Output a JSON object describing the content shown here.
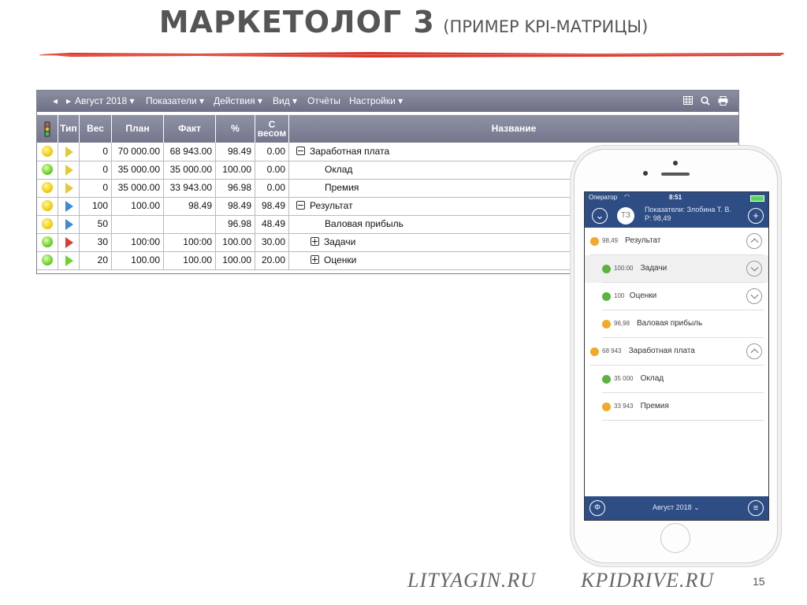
{
  "slide": {
    "title_main": "МАРКЕТОЛОГ 3",
    "title_sub": "(ПРИМЕР KPI-МАТРИЦЫ)",
    "page_number": "15",
    "site1": "LITYAGIN.RU",
    "site2": "KPIDRIVE.RU"
  },
  "colors": {
    "accent_red": "#d9362b",
    "toolbar": "#7a7c91",
    "phone_bar": "#2e4d84",
    "dot_yellow": "#f0cf10",
    "dot_green": "#6fd12e",
    "dot_orange": "#f0a928"
  },
  "desktop": {
    "toolbar": {
      "prev_icon": "triangle-left-icon",
      "next_icon": "triangle-right-icon",
      "period": "Август 2018",
      "menu": [
        "Показатели",
        "Действия",
        "Вид",
        "Отчёты",
        "Настройки"
      ],
      "right_icons": [
        "table-icon",
        "search-icon",
        "print-icon"
      ]
    },
    "headers": {
      "type": "Тип",
      "weight": "Вес",
      "plan": "План",
      "fact": "Факт",
      "percent": "%",
      "with_weight_1": "С",
      "with_weight_2": "весом",
      "name": "Название"
    },
    "rows": [
      {
        "status": "yellow",
        "type": "yellow",
        "weight": "0",
        "plan": "70 000.00",
        "fact": "68 943.00",
        "percent": "98.49",
        "weighted": "0.00",
        "name": "Заработная плата",
        "tree": "minus",
        "indent": 0
      },
      {
        "status": "green",
        "type": "yellow",
        "weight": "0",
        "plan": "35 000.00",
        "fact": "35 000.00",
        "percent": "100.00",
        "weighted": "0.00",
        "name": "Оклад",
        "tree": "",
        "indent": 2
      },
      {
        "status": "yellow",
        "type": "yellow",
        "weight": "0",
        "plan": "35 000.00",
        "fact": "33 943.00",
        "percent": "96.98",
        "weighted": "0.00",
        "name": "Премия",
        "tree": "",
        "indent": 2
      },
      {
        "status": "yellow",
        "type": "blue",
        "weight": "100",
        "plan": "100.00",
        "fact": "98.49",
        "percent": "98.49",
        "weighted": "98.49",
        "name": "Результат",
        "tree": "minus",
        "indent": 0
      },
      {
        "status": "yellow",
        "type": "blue",
        "weight": "50",
        "plan": "",
        "fact": "",
        "percent": "96.98",
        "weighted": "48.49",
        "name": "Валовая прибыль",
        "tree": "",
        "indent": 2
      },
      {
        "status": "green",
        "type": "red",
        "weight": "30",
        "plan": "100:00",
        "fact": "100:00",
        "percent": "100.00",
        "weighted": "30.00",
        "name": "Задачи",
        "tree": "plus",
        "indent": 1
      },
      {
        "status": "green",
        "type": "green",
        "weight": "20",
        "plan": "100.00",
        "fact": "100.00",
        "percent": "100.00",
        "weighted": "20.00",
        "name": "Оценки",
        "tree": "plus",
        "indent": 1
      }
    ]
  },
  "phone": {
    "status": {
      "carrier": "Оператор",
      "time": "8:51"
    },
    "nav": {
      "avatar": "ТЗ",
      "line1": "Показатели: Злобина Т. В.",
      "line2": "Р: 98,49",
      "left_icon": "chevron-down-circle-icon",
      "right_icon": "plus-circle-icon"
    },
    "items": [
      {
        "value": "98,49",
        "label": "Результат",
        "dot": "orange",
        "indent": 0,
        "chevron": "up",
        "shaded": false
      },
      {
        "value": "100:00",
        "label": "Задачи",
        "dot": "green",
        "indent": 1,
        "chevron": "down",
        "shaded": true
      },
      {
        "value": "100",
        "label": "Оценки",
        "dot": "green",
        "indent": 1,
        "chevron": "down",
        "shaded": false
      },
      {
        "value": "96,98",
        "label": "Валовая прибыль",
        "dot": "orange",
        "indent": 1,
        "chevron": "",
        "shaded": false
      },
      {
        "value": "68 943",
        "label": "Заработная плата",
        "dot": "orange",
        "indent": 0,
        "chevron": "up",
        "shaded": false
      },
      {
        "value": "35 000",
        "label": "Оклад",
        "dot": "green",
        "indent": 1,
        "chevron": "",
        "shaded": false
      },
      {
        "value": "33 943",
        "label": "Премия",
        "dot": "orange",
        "indent": 1,
        "chevron": "",
        "shaded": false
      }
    ],
    "footer": {
      "period": "Август 2018",
      "left_icon": "phi-icon",
      "right_icon": "menu-icon"
    }
  }
}
